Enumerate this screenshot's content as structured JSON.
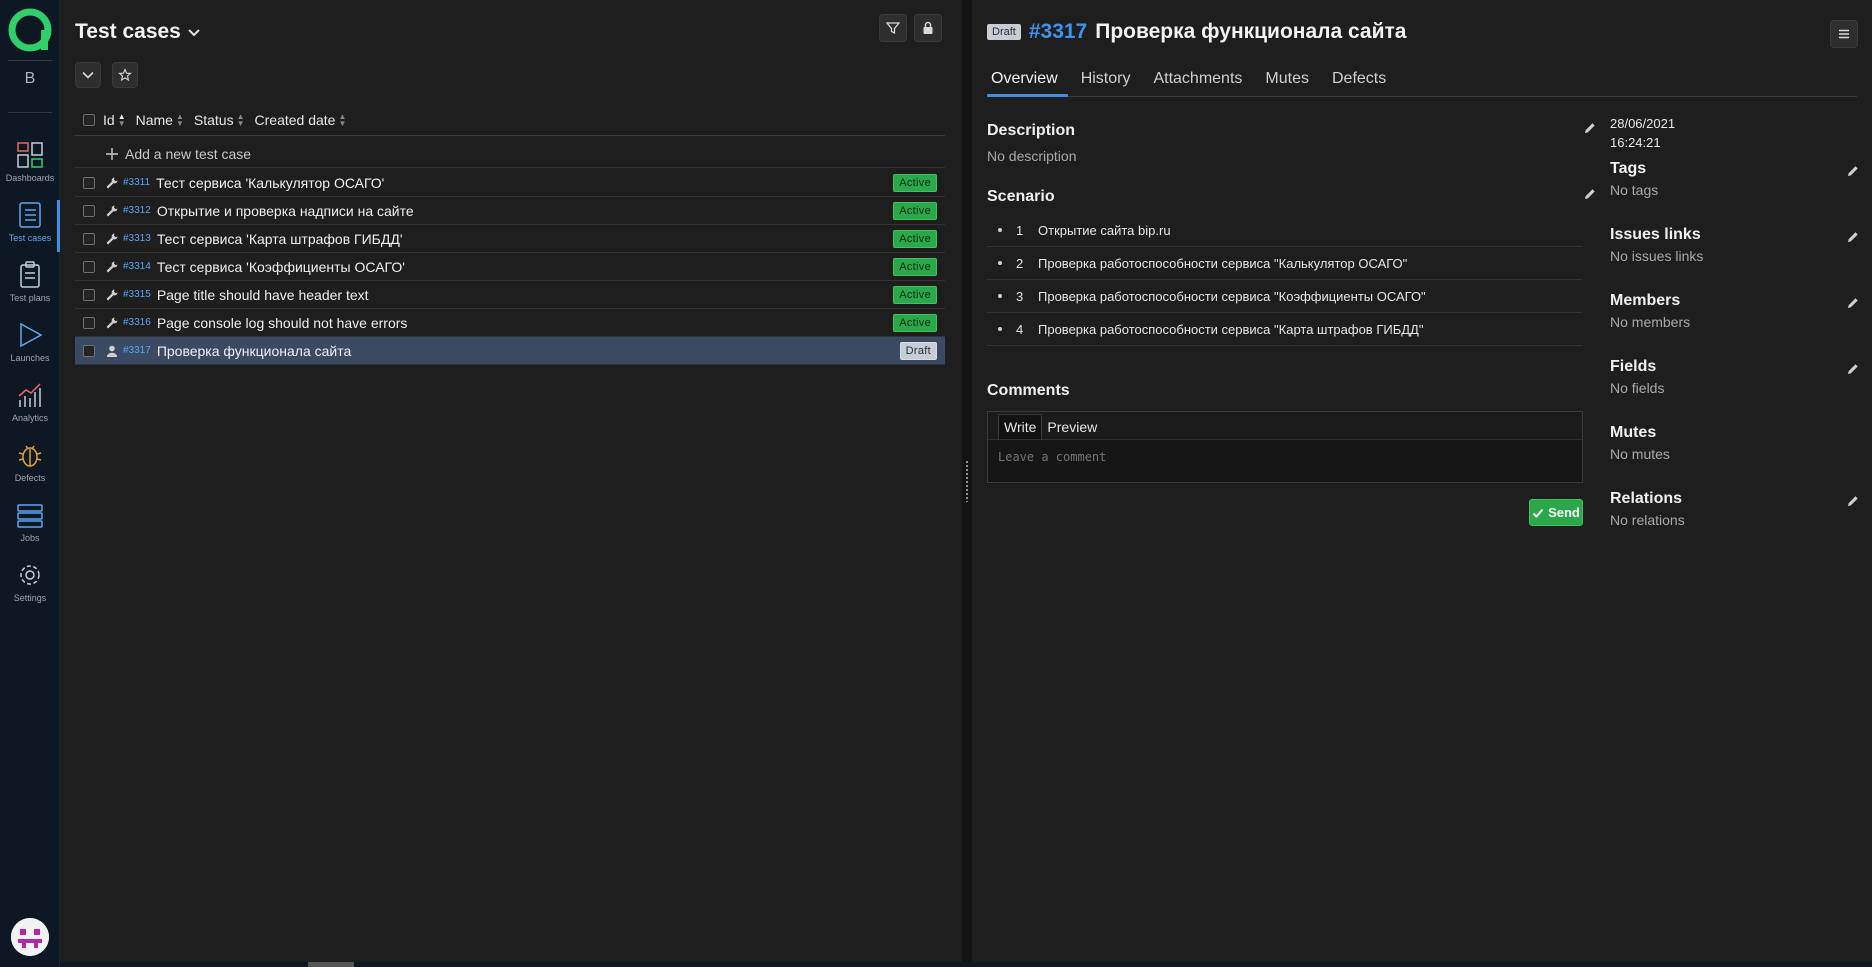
{
  "sidebar": {
    "project_letter": "B",
    "items": [
      {
        "label": "Dashboards",
        "icon": "dashboards-icon"
      },
      {
        "label": "Test cases",
        "icon": "test-cases-icon"
      },
      {
        "label": "Test plans",
        "icon": "test-plans-icon"
      },
      {
        "label": "Launches",
        "icon": "launches-icon"
      },
      {
        "label": "Analytics",
        "icon": "analytics-icon"
      },
      {
        "label": "Defects",
        "icon": "defects-icon"
      },
      {
        "label": "Jobs",
        "icon": "jobs-icon"
      },
      {
        "label": "Settings",
        "icon": "settings-icon"
      }
    ],
    "active_index": 1
  },
  "list": {
    "title": "Test cases",
    "columns": {
      "id": "Id",
      "name": "Name",
      "status": "Status",
      "created": "Created date"
    },
    "add_label": "Add a new test case",
    "rows": [
      {
        "id": "#3311",
        "name": "Тест сервиса 'Калькулятор ОСАГО'",
        "status": "Active"
      },
      {
        "id": "#3312",
        "name": "Открытие и проверка надписи на сайте",
        "status": "Active"
      },
      {
        "id": "#3313",
        "name": "Тест сервиса 'Карта штрафов ГИБДД'",
        "status": "Active"
      },
      {
        "id": "#3314",
        "name": "Тест сервиса 'Коэффициенты ОСАГО'",
        "status": "Active"
      },
      {
        "id": "#3315",
        "name": "Page title should have header text",
        "status": "Active"
      },
      {
        "id": "#3316",
        "name": "Page console log should not have errors",
        "status": "Active"
      },
      {
        "id": "#3317",
        "name": "Проверка функционала сайта",
        "status": "Draft"
      }
    ]
  },
  "detail": {
    "status_chip": "Draft",
    "number": "#3317",
    "title": "Проверка функционала сайта",
    "tabs": [
      "Overview",
      "History",
      "Attachments",
      "Mutes",
      "Defects"
    ],
    "description_title": "Description",
    "description_text": "No description",
    "scenario_title": "Scenario",
    "steps": [
      {
        "n": "1",
        "text": "Открытие сайта bip.ru"
      },
      {
        "n": "2",
        "text": "Проверка работоспособности сервиса \"Калькулятор ОСАГО\""
      },
      {
        "n": "3",
        "text": "Проверка работоспособности сервиса \"Коэффициенты ОСАГО\""
      },
      {
        "n": "4",
        "text": "Проверка работоспособности сервиса \"Карта штрафов ГИБДД\""
      }
    ],
    "comments_title": "Comments",
    "comment_tabs": {
      "write": "Write",
      "preview": "Preview"
    },
    "comment_placeholder": "Leave a comment",
    "send_label": "Send",
    "meta": {
      "date": "28/06/2021",
      "time": "16:24:21",
      "tags": {
        "title": "Tags",
        "value": "No tags"
      },
      "issues": {
        "title": "Issues links",
        "value": "No issues links"
      },
      "members": {
        "title": "Members",
        "value": "No members"
      },
      "fields": {
        "title": "Fields",
        "value": "No fields"
      },
      "mutes": {
        "title": "Mutes",
        "value": "No mutes"
      },
      "relations": {
        "title": "Relations",
        "value": "No relations"
      }
    }
  },
  "colors": {
    "accent": "#3d8fe6",
    "active_badge": "#2aa84a",
    "logo": "#2fd06a"
  }
}
